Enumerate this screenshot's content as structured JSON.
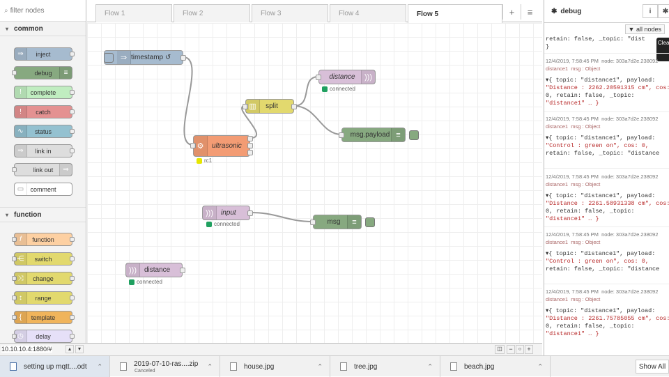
{
  "palette": {
    "search_placeholder": "filter nodes",
    "categories": [
      {
        "label": "common",
        "nodes": [
          "inject",
          "debug",
          "complete",
          "catch",
          "status",
          "link in",
          "link out",
          "comment"
        ]
      },
      {
        "label": "function",
        "nodes": [
          "function",
          "switch",
          "change",
          "range",
          "template",
          "delay"
        ]
      }
    ]
  },
  "tabs": [
    "Flow 1",
    "Flow 2",
    "Flow 3",
    "Flow 4",
    "Flow 5"
  ],
  "active_tab": "Flow 5",
  "flow_nodes": {
    "timestamp": "timestamp ↺",
    "ultrasonic": "ultrasonic",
    "ultrasonic_status": "rc1",
    "split": "split",
    "distance_out": "distance",
    "distance_out_status": "connected",
    "msg_payload": "msg.payload",
    "input": "input",
    "input_status": "connected",
    "msg": "msg",
    "distance_in": "distance",
    "distance_in_status": "connected"
  },
  "footer": {
    "url": "10.10.10.4:1880/#"
  },
  "sidebar": {
    "title": "debug",
    "filter_label": "all nodes",
    "clear_label": "Clea",
    "top_fragment": "retain: false, _topic: \"dist",
    "top_close": "}",
    "messages": [
      {
        "time": "12/4/2019, 7:58:45 PM",
        "node": "node: 303a7d2e.238092",
        "source": "distance1",
        "type": "msg : Object",
        "lines": [
          "▾{ topic: \"distance1\", payload:",
          "\"Distance : 2262.20591315 cm\", cos:",
          "0, retain: false, _topic:",
          "\"distance1\" … }"
        ]
      },
      {
        "time": "12/4/2019, 7:58:45 PM",
        "node": "node: 303a7d2e.238092",
        "source": "distance1",
        "type": "msg : Object",
        "lines": [
          "▾{ topic: \"distance1\", payload:",
          "\"Control : green on\", cos: 0,",
          "retain: false, _topic: \"distance"
        ]
      },
      {
        "time": "12/4/2019, 7:58:45 PM",
        "node": "node: 303a7d2e.238092",
        "source": "distance1",
        "type": "msg : Object",
        "lines": [
          "▾{ topic: \"distance1\", payload:",
          "\"Distance : 2261.58931338 cm\", cos:",
          "0, retain: false, _topic:",
          "\"distance1\" … }"
        ]
      },
      {
        "time": "12/4/2019, 7:58:45 PM",
        "node": "node: 303a7d2e.238092",
        "source": "distance1",
        "type": "msg : Object",
        "lines": [
          "▾{ topic: \"distance1\", payload:",
          "\"Control : green on\", cos: 0,",
          "retain: false, _topic: \"distance"
        ]
      },
      {
        "time": "12/4/2019, 7:58:45 PM",
        "node": "node: 303a7d2e.238092",
        "source": "distance1",
        "type": "msg : Object",
        "lines": [
          "▾{ topic: \"distance1\", payload:",
          "\"Distance : 2261.75785055 cm\", cos:",
          "0, retain: false, _topic:",
          "\"distance1\" … }"
        ]
      }
    ]
  },
  "downloads": [
    {
      "name": "setting up mqtt....odt",
      "sub": ""
    },
    {
      "name": "2019-07-10-ras....zip",
      "sub": "Canceled"
    },
    {
      "name": "house.jpg",
      "sub": ""
    },
    {
      "name": "tree.jpg",
      "sub": ""
    },
    {
      "name": "beach.jpg",
      "sub": ""
    }
  ],
  "show_all": "Show All",
  "colors": {
    "inject": "#a6bbcf",
    "debug": "#87a980",
    "complete": "#c0edc0",
    "catch": "#e49191",
    "status": "#94c1d0",
    "link": "#dddddd",
    "comment": "#ffffff",
    "function": "#fdd0a2",
    "switch": "#e2d96e",
    "change": "#e2d96e",
    "range": "#e2d96e",
    "template": "#f0b45b",
    "delay": "#e6e0f8",
    "mqtt": "#d8bfd8",
    "ultrasonic": "#f39c74",
    "status_green": "#20a060",
    "status_yellow": "#e6e600"
  }
}
